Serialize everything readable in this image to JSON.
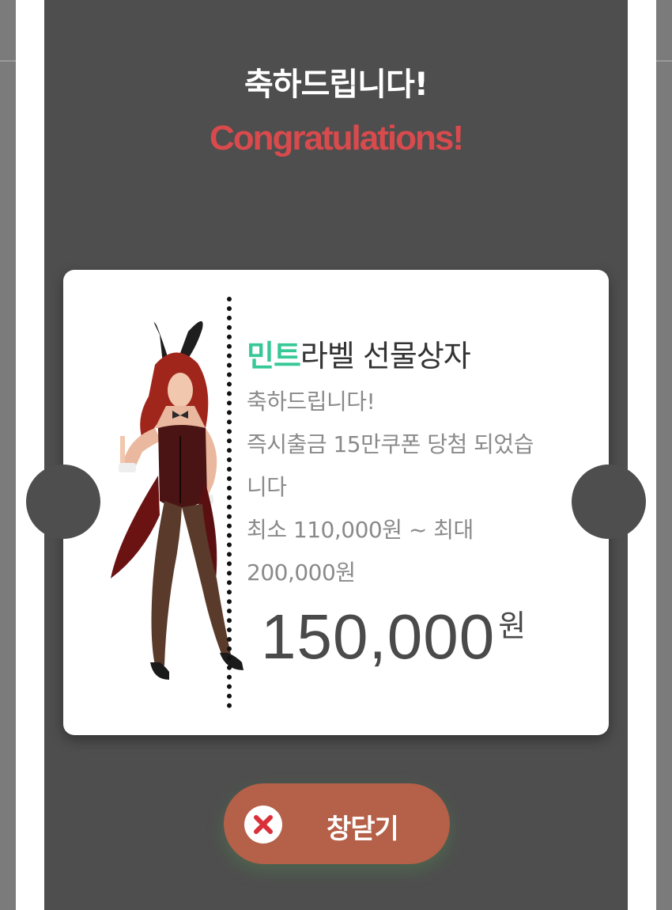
{
  "modal": {
    "title_korean": "축하드립니다!",
    "title_english": "Congratulations!"
  },
  "ticket": {
    "product_name_accent": "민트",
    "product_name_rest": "라벨 선물상자",
    "description_lines": [
      "축하드립니다!",
      "즉시출금 15만쿠폰 당첨 되었습",
      "니다",
      "최소 110,000원 ~ 최대",
      "200,000원"
    ],
    "amount_value": "150,000",
    "amount_unit": "원"
  },
  "close_button": {
    "label": "창닫기"
  },
  "colors": {
    "accent_mint": "#37c897",
    "title_red": "#d94a4d",
    "button_bg": "#b56048",
    "overlay_bg": "#4e4e4e"
  },
  "icons": {
    "close": "close-icon"
  }
}
